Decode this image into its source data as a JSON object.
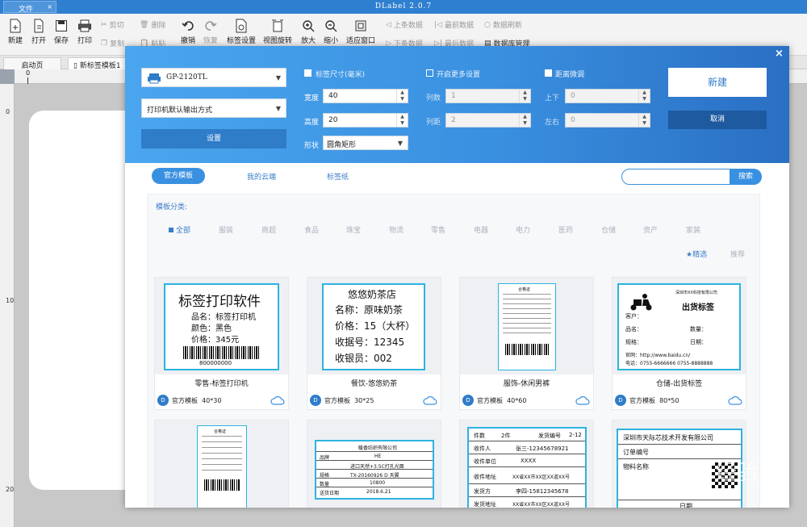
{
  "app": {
    "file_tab": "文件",
    "title": "DLabel 2.0.7"
  },
  "toolbar": {
    "new": "新建",
    "open": "打开",
    "save": "保存",
    "print": "打印",
    "cut": "剪切",
    "copy": "复制",
    "delete": "删除",
    "paste": "粘贴",
    "undo": "撤销",
    "redo": "恢复",
    "label_setup": "标签设置",
    "view_rotate": "视图旋转",
    "zoom_in": "放大",
    "zoom_out": "缩小",
    "fit_window": "适应窗口",
    "prev_record": "上条数据",
    "next_record": "下条数据",
    "first_record": "最前数据",
    "last_record": "最后数据",
    "refresh_data": "数据刷新",
    "data_manage": "数据库管理"
  },
  "doctabs": {
    "start": "启动页",
    "new_template": "新标签模板1"
  },
  "ruler": {
    "h0": "0",
    "v0": "0",
    "v10": "10",
    "v20": "20"
  },
  "dialog": {
    "printer": "GP-2120TL",
    "print_mode": "打印机默认输出方式",
    "setup_btn": "设置",
    "size_header": "标签尺寸(毫米)",
    "width_label": "宽度",
    "width_value": "40",
    "height_label": "高度",
    "height_value": "20",
    "shape_label": "形状",
    "shape_value": "圆角矩形",
    "more_header": "开启更多设置",
    "cols_label": "列数",
    "cols_value": "1",
    "colgap_label": "列距",
    "colgap_value": "2",
    "fine_header": "距离微调",
    "ud_label": "上下",
    "ud_value": "0",
    "lr_label": "左右",
    "lr_value": "0",
    "new_btn": "新建",
    "cancel_btn": "取消"
  },
  "tabs": {
    "official": "官方模板",
    "cloud": "我的云端",
    "spec": "标签纸",
    "search_btn": "搜索",
    "search_value": ""
  },
  "categories": {
    "title": "模板分类:",
    "items": [
      "全部",
      "服装",
      "商超",
      "食品",
      "珠宝",
      "物流",
      "零售",
      "电器",
      "电力",
      "医药",
      "仓储",
      "资产",
      "家装"
    ]
  },
  "sort": {
    "featured": "★精选",
    "recommend": "推荐"
  },
  "cards": [
    {
      "name": "零售-标签打印机",
      "src": "官方模板",
      "size": "40*30",
      "badge": "D"
    },
    {
      "name": "餐饮-悠悠奶茶",
      "src": "官方模板",
      "size": "30*25",
      "badge": "D"
    },
    {
      "name": "服饰-休闲男裤",
      "src": "官方模板",
      "size": "40*60",
      "badge": "D"
    },
    {
      "name": "仓储-出货标签",
      "src": "官方模板",
      "size": "80*50",
      "badge": "D"
    }
  ],
  "label1": {
    "title": "标签打印软件",
    "l1": "品名：标签打印机",
    "l2": "颜色：黑色",
    "l3": "价格：345元",
    "code": "800000000"
  },
  "label2": {
    "title": "悠悠奶茶店",
    "l1": "名称：原味奶茶",
    "l2": "价格：15（大杯）",
    "l3": "收据号：12345",
    "l4": "收银员：002"
  },
  "label3": {
    "title": "合格证"
  },
  "label4": {
    "title": "出货标签",
    "company": "深圳市XX科技有限公司",
    "customer": "客户：",
    "product": "品名：",
    "qty": "数量：",
    "spec": "规格：",
    "date": "日期：",
    "site": "官网：http://www.baidu.cn/",
    "tel": "电话：0755-6666666  0755-8888888"
  },
  "label5": {
    "title": "合格证"
  },
  "label6": {
    "company": "暖香纺织有限公司",
    "brand": "品牌",
    "brand_v": "HE",
    "r2": "进口天然+3.5C打孔光面",
    "model": "规格",
    "model_v": "TX-20160926 D 天翼",
    "qty": "数量",
    "qty_v": "10800",
    "date": "送货日期",
    "date_v": "2018.6.21"
  },
  "label7": {
    "pieces": "件数",
    "pieces_v": "2件",
    "sendno": "发货编号",
    "sendno_v": "2-12",
    "receiver": "收件人",
    "receiver_v": "张三-12345678921",
    "unit": "收件单位",
    "unit_v": "XXXX",
    "addr": "收件地址",
    "addr_v": "XX省XX市XX区XX道XX号",
    "sender": "发货方",
    "sender_v": "李四-15812345678",
    "saddr": "发货地址",
    "saddr_v": "XX省XX市XX区XX道XX号"
  },
  "label8": {
    "company": "深圳市天际芯技术开发有限公司",
    "order": "订单编号",
    "goods": "物料名称",
    "date": "日期"
  },
  "watermark": {
    "text": "Baidu 经验",
    "url": "jingyan.baidu.com"
  },
  "colors": {
    "brand": "#2f7fd0",
    "accent": "#3a90e0",
    "label_border": "#2cb3e0"
  }
}
